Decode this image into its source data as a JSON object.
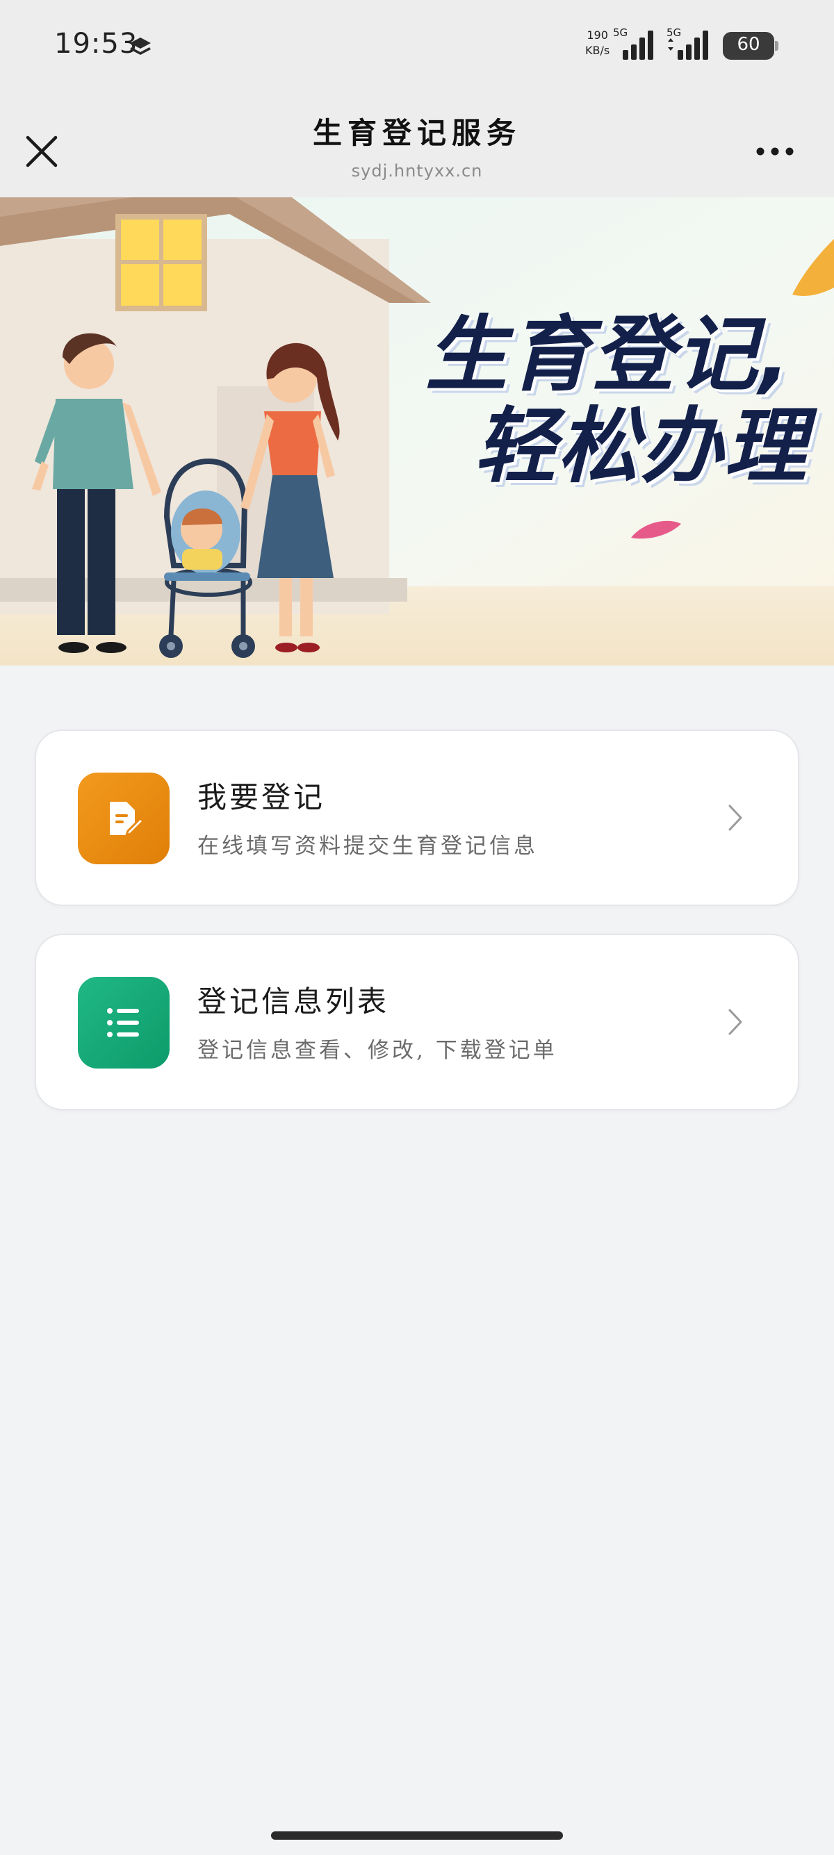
{
  "status_bar": {
    "time": "19:53",
    "net_speed_value": "190",
    "net_speed_unit": "KB/s",
    "signal_1_label": "5G",
    "signal_2_label": "5G",
    "battery": "60",
    "icons": [
      "layers-icon",
      "signal-icon",
      "battery-icon"
    ]
  },
  "header": {
    "title": "生育登记服务",
    "url": "sydj.hntyxx.cn",
    "close_icon": "close-icon",
    "more_icon": "more-icon"
  },
  "banner": {
    "line1": "生育登记,",
    "line2": "轻松办理"
  },
  "cards": [
    {
      "title": "我要登记",
      "subtitle": "在线填写资料提交生育登记信息",
      "icon": "document-edit-icon",
      "color": "#ee8c12"
    },
    {
      "title": "登记信息列表",
      "subtitle": "登记信息查看、修改, 下载登记单",
      "icon": "list-icon",
      "color": "#16ab78"
    }
  ],
  "colors": {
    "background": "#f2f3f5",
    "header_bg": "#ededed",
    "banner_text": "#13204a"
  }
}
